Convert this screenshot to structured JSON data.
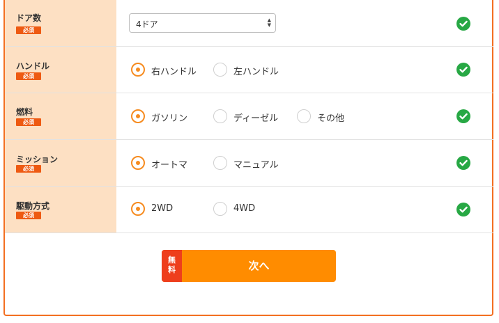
{
  "form": {
    "required_label": "必須",
    "rows": [
      {
        "label": "ドア数",
        "type": "select",
        "value": "4ドア"
      },
      {
        "label": "ハンドル",
        "type": "radio",
        "options": [
          "右ハンドル",
          "左ハンドル"
        ],
        "selected": 0
      },
      {
        "label": "燃料",
        "type": "radio",
        "options": [
          "ガソリン",
          "ディーゼル",
          "その他"
        ],
        "selected": 0
      },
      {
        "label": "ミッション",
        "type": "radio",
        "options": [
          "オートマ",
          "マニュアル"
        ],
        "selected": 0
      },
      {
        "label": "駆動方式",
        "type": "radio",
        "options": [
          "2WD",
          "4WD"
        ],
        "selected": 0
      }
    ],
    "status_icon": "check-circle-icon"
  },
  "submit": {
    "free_line1": "無",
    "free_line2": "料",
    "label": "次へ"
  },
  "colors": {
    "accent": "#ff8c00",
    "required": "#ee5a12",
    "label_bg": "#fde0c3",
    "check": "#27a844"
  }
}
